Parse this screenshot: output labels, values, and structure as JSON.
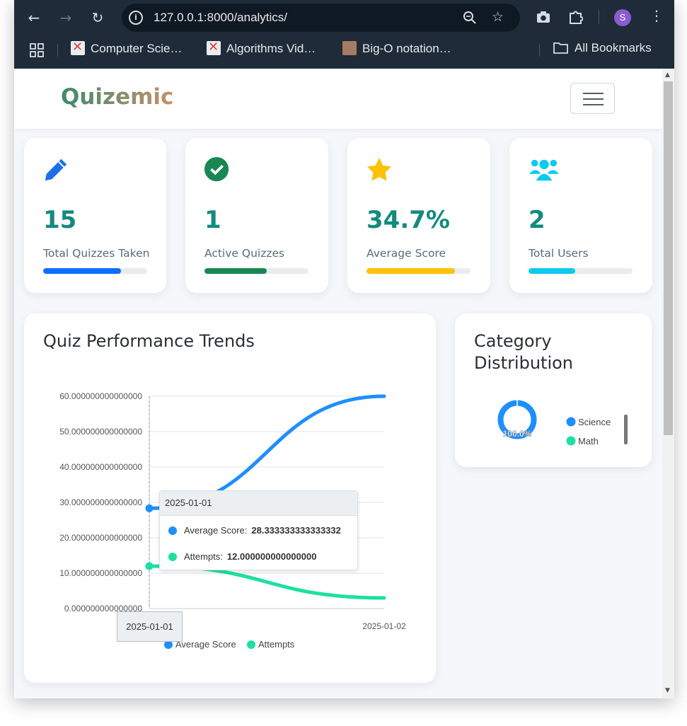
{
  "browser": {
    "url": "127.0.0.1:8000/analytics/",
    "bookmarks": [
      "Computer Scie…",
      "Algorithms Vid…",
      "Big-O notation…"
    ],
    "all_bookmarks_label": "All Bookmarks",
    "profile_initial": "S"
  },
  "app": {
    "brand": "Quizemic"
  },
  "stats": [
    {
      "icon": "pencil-icon",
      "value": "15",
      "label": "Total Quizzes Taken",
      "progress": 0.75,
      "color": "#0d6efd"
    },
    {
      "icon": "check-circle-icon",
      "value": "1",
      "label": "Active Quizzes",
      "progress": 0.6,
      "color": "#198754"
    },
    {
      "icon": "star-icon",
      "value": "34.7%",
      "label": "Average Score",
      "progress": 0.85,
      "color": "#ffc107"
    },
    {
      "icon": "users-icon",
      "value": "2",
      "label": "Total Users",
      "progress": 0.45,
      "color": "#0dcaf0"
    }
  ],
  "performance": {
    "title": "Quiz Performance Trends",
    "tooltip": {
      "date": "2025-01-01",
      "rows": [
        {
          "label": "Average Score:",
          "value": "28.333333333333332",
          "color": "#1e8fff"
        },
        {
          "label": "Attempts:",
          "value": "12.000000000000000",
          "color": "#1de0a0"
        }
      ]
    },
    "x_tooltip": "2025-01-01"
  },
  "category": {
    "title": "Category Distribution",
    "donut_label": "100.0%"
  },
  "chart_data": [
    {
      "type": "line",
      "title": "Quiz Performance Trends",
      "x": [
        "2025-01-01",
        "2025-01-02"
      ],
      "series": [
        {
          "name": "Average Score",
          "values": [
            28.333333333333332,
            60
          ],
          "color": "#1e8fff"
        },
        {
          "name": "Attempts",
          "values": [
            12,
            3
          ],
          "color": "#1de0a0"
        }
      ],
      "ylim": [
        0,
        60
      ],
      "yticks": [
        "0.000000000000000",
        "10.000000000000000",
        "20.000000000000000",
        "30.000000000000000",
        "40.000000000000000",
        "50.000000000000000",
        "60.000000000000000"
      ],
      "xticks": [
        "2025-01-01",
        "2025-01-02"
      ],
      "legend": "bottom",
      "grid": true
    },
    {
      "type": "pie",
      "title": "Category Distribution",
      "categories": [
        "Science",
        "Math"
      ],
      "values": [
        100,
        0
      ],
      "colors": [
        "#1e8fff",
        "#1de0a0"
      ],
      "legend": "right"
    }
  ]
}
